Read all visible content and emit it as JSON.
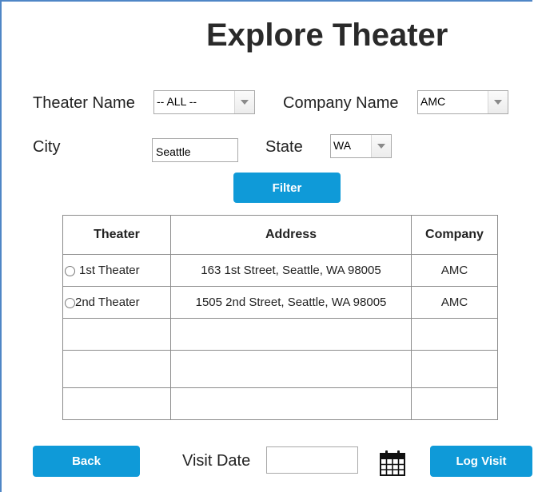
{
  "title": "Explore Theater",
  "filters": {
    "theater_name_label": "Theater Name",
    "theater_name_value": "-- ALL --",
    "company_name_label": "Company Name",
    "company_name_value": "AMC",
    "city_label": "City",
    "city_value": "Seattle",
    "state_label": "State",
    "state_value": "WA",
    "filter_button": "Filter"
  },
  "table": {
    "headers": [
      "Theater",
      "Address",
      "Company"
    ],
    "rows": [
      {
        "theater": "1st Theater",
        "address": "163 1st Street, Seattle, WA 98005",
        "company": "AMC"
      },
      {
        "theater": "2nd Theater",
        "address": "1505 2nd Street, Seattle, WA 98005",
        "company": "AMC"
      }
    ]
  },
  "footer": {
    "back_button": "Back",
    "visit_date_label": "Visit Date",
    "visit_date_value": "",
    "log_visit_button": "Log Visit",
    "calendar_icon": "calendar-icon"
  }
}
